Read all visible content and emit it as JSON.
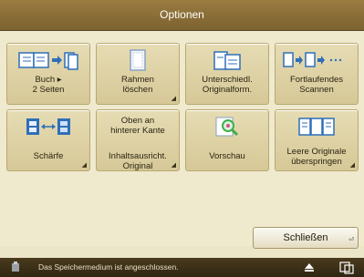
{
  "window": {
    "title": "Optionen"
  },
  "options": [
    {
      "label": "Buch ▸\n2 Seiten",
      "icon": "book-to-two-pages-icon",
      "has_menu": false
    },
    {
      "label": "Rahmen\nlöschen",
      "icon": "frame-erase-icon",
      "has_menu": true
    },
    {
      "label": "Unterschiedl.\nOriginalform.",
      "icon": "mixed-originals-icon",
      "has_menu": false
    },
    {
      "label": "Fortlaufendes\nScannen",
      "icon": "continuous-scan-icon",
      "has_menu": false
    },
    {
      "label": "Schärfe",
      "icon": "sharpness-icon",
      "has_menu": true
    },
    {
      "label": "Inhaltsausricht.\nOriginal",
      "top_label": "Oben an\nhinterer Kante",
      "icon": "",
      "has_menu": true
    },
    {
      "label": "Vorschau",
      "icon": "preview-magnifier-icon",
      "has_menu": false
    },
    {
      "label": "Leere Originale\nüberspringen",
      "icon": "skip-blank-originals-icon",
      "has_menu": true
    }
  ],
  "close_label": "Schließen",
  "status": {
    "message": "Das Speichermedium ist angeschlossen.",
    "eject_icon": "eject-icon",
    "device_icon": "device-status-icon"
  },
  "colors": {
    "header": "#8a6d36",
    "tile": "#ddd0a3",
    "panel": "#efe9cd",
    "icon_blue": "#2f6fb8",
    "icon_green": "#3fae4c"
  }
}
